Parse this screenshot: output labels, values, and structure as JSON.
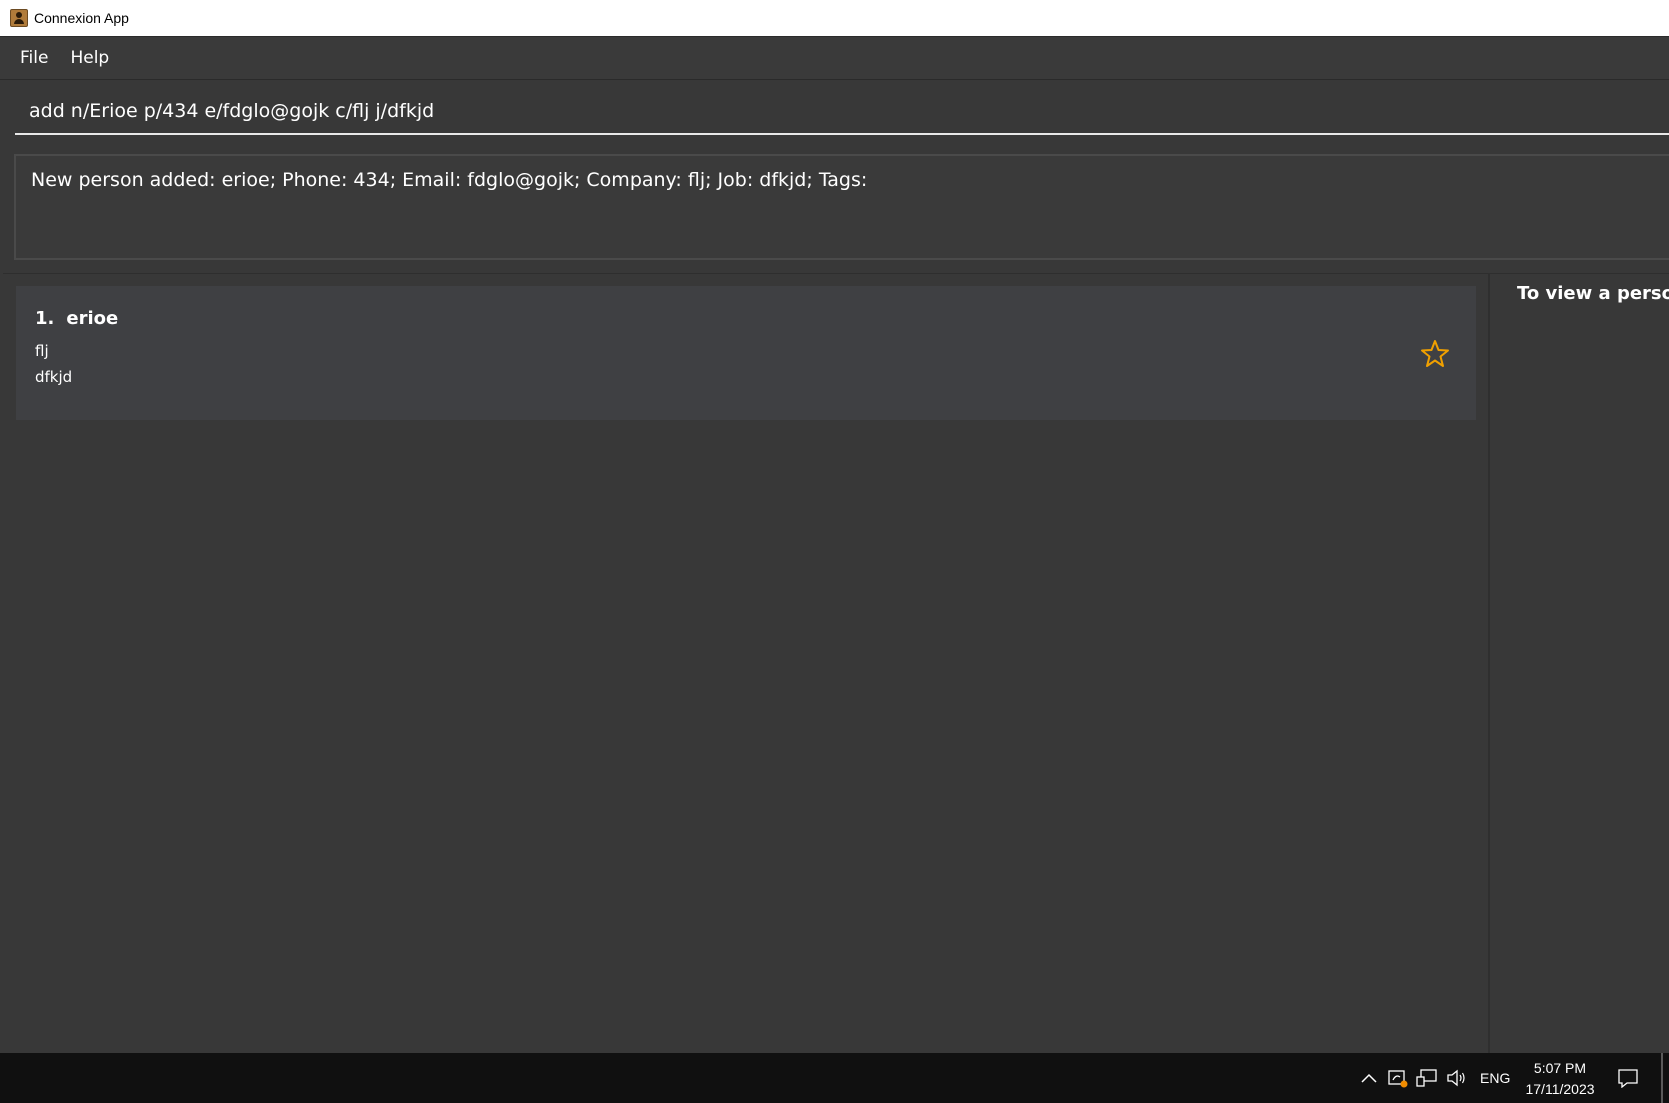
{
  "window": {
    "title": "Connexion App"
  },
  "menu": {
    "items": [
      {
        "label": "File"
      },
      {
        "label": "Help"
      }
    ]
  },
  "command": {
    "value": "add n/Erioe p/434 e/fdglo@gojk c/flj j/dfkjd"
  },
  "result": {
    "text": "New person added: erioe; Phone: 434; Email: fdglo@gojk; Company: flj; Job: dfkjd; Tags:"
  },
  "persons": [
    {
      "index": "1.",
      "name": "erioe",
      "company": "flj",
      "job": "dfkjd",
      "favourite_icon": "star-outline-icon"
    }
  ],
  "detail": {
    "hint": "To view a person"
  },
  "taskbar": {
    "language": "ENG",
    "time": "5:07 PM",
    "date": "17/11/2023",
    "icons": [
      "chevron-up-icon",
      "security-icon",
      "network-icon",
      "volume-icon",
      "notification-icon"
    ]
  },
  "colors": {
    "background": "#383838",
    "card": "#3f4043",
    "star": "#f0a000"
  }
}
